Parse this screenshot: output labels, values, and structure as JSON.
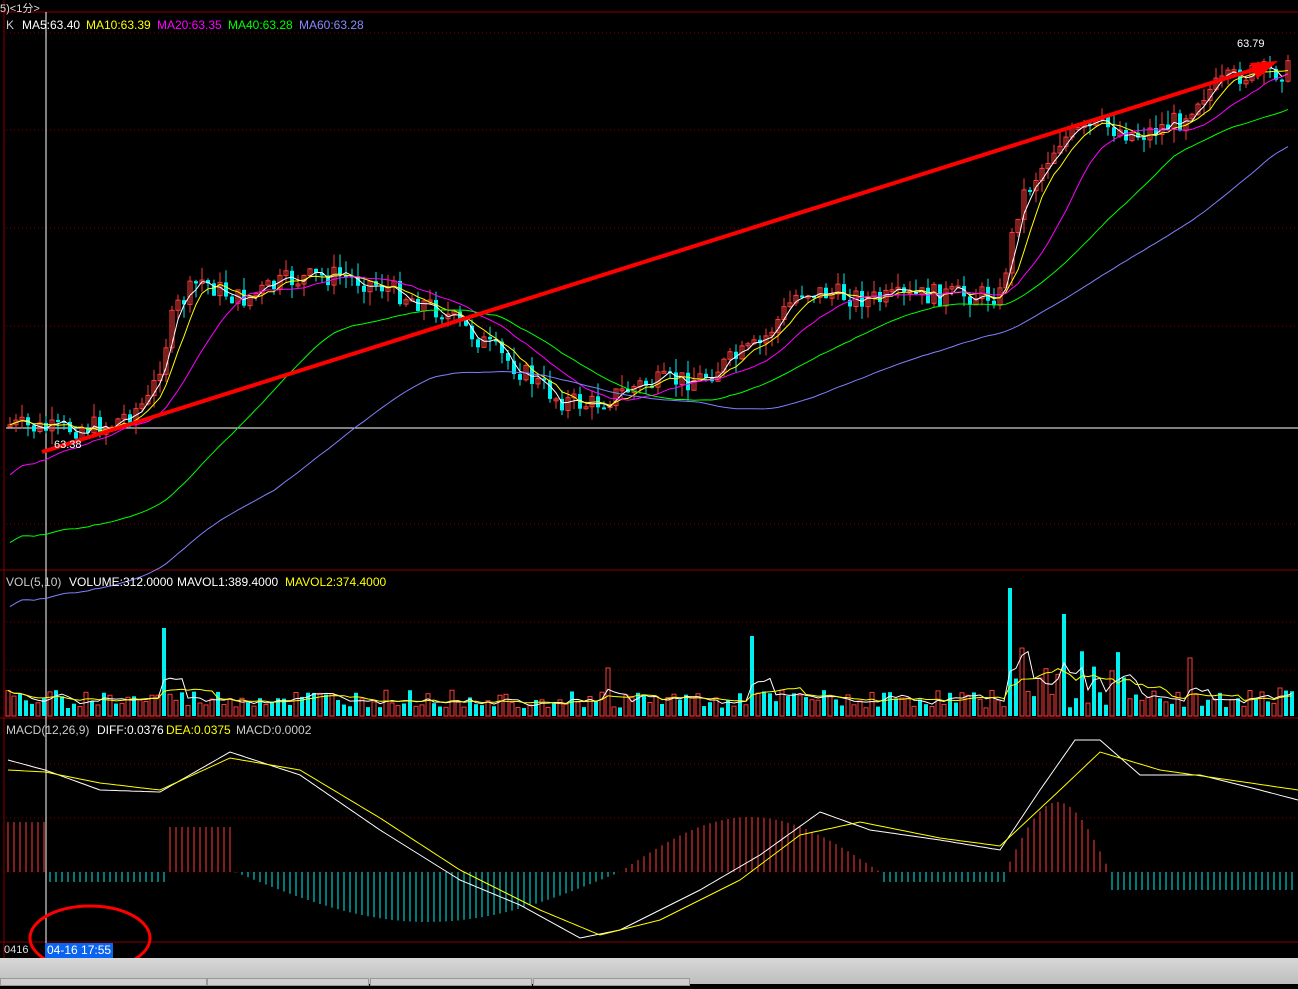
{
  "topbar": {
    "label": "5)<1分>"
  },
  "kline": {
    "indicator_prefix": "K",
    "ma5": "MA5:63.40",
    "ma10": "MA10:63.39",
    "ma20": "MA20:63.35",
    "ma40": "MA40:63.28",
    "ma60": "MA60:63.28",
    "high_label": "63.79",
    "low_label": "63.38"
  },
  "volume": {
    "title": "VOL(5,10)",
    "volume": "VOLUME:312.0000",
    "mavol1": "MAVOL1:389.4000",
    "mavol2": "MAVOL2:374.4000"
  },
  "macd": {
    "title": "MACD(12,26,9)",
    "diff": "DIFF:0.0376",
    "dea": "DEA:0.0375",
    "macd": "MACD:0.0002"
  },
  "footer": {
    "date_label": "0416",
    "cursor_time": "04-16 17:55"
  },
  "colors": {
    "up": "#ff3b3b",
    "down": "#00f0f0",
    "ma5": "#ffffff",
    "ma10": "#ffff00",
    "ma20": "#ff00ff",
    "ma40": "#00ff00",
    "ma60": "#8080ff",
    "grid": "#880000",
    "annotation": "#ff0000"
  }
}
